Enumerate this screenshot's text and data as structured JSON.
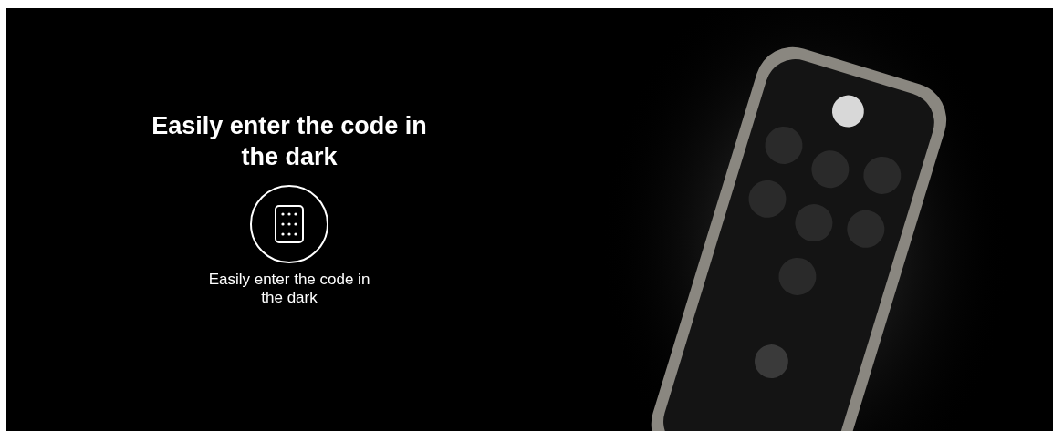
{
  "feature": {
    "heading": "Easily enter the code in the dark",
    "caption": "Easily enter the code in the dark"
  }
}
